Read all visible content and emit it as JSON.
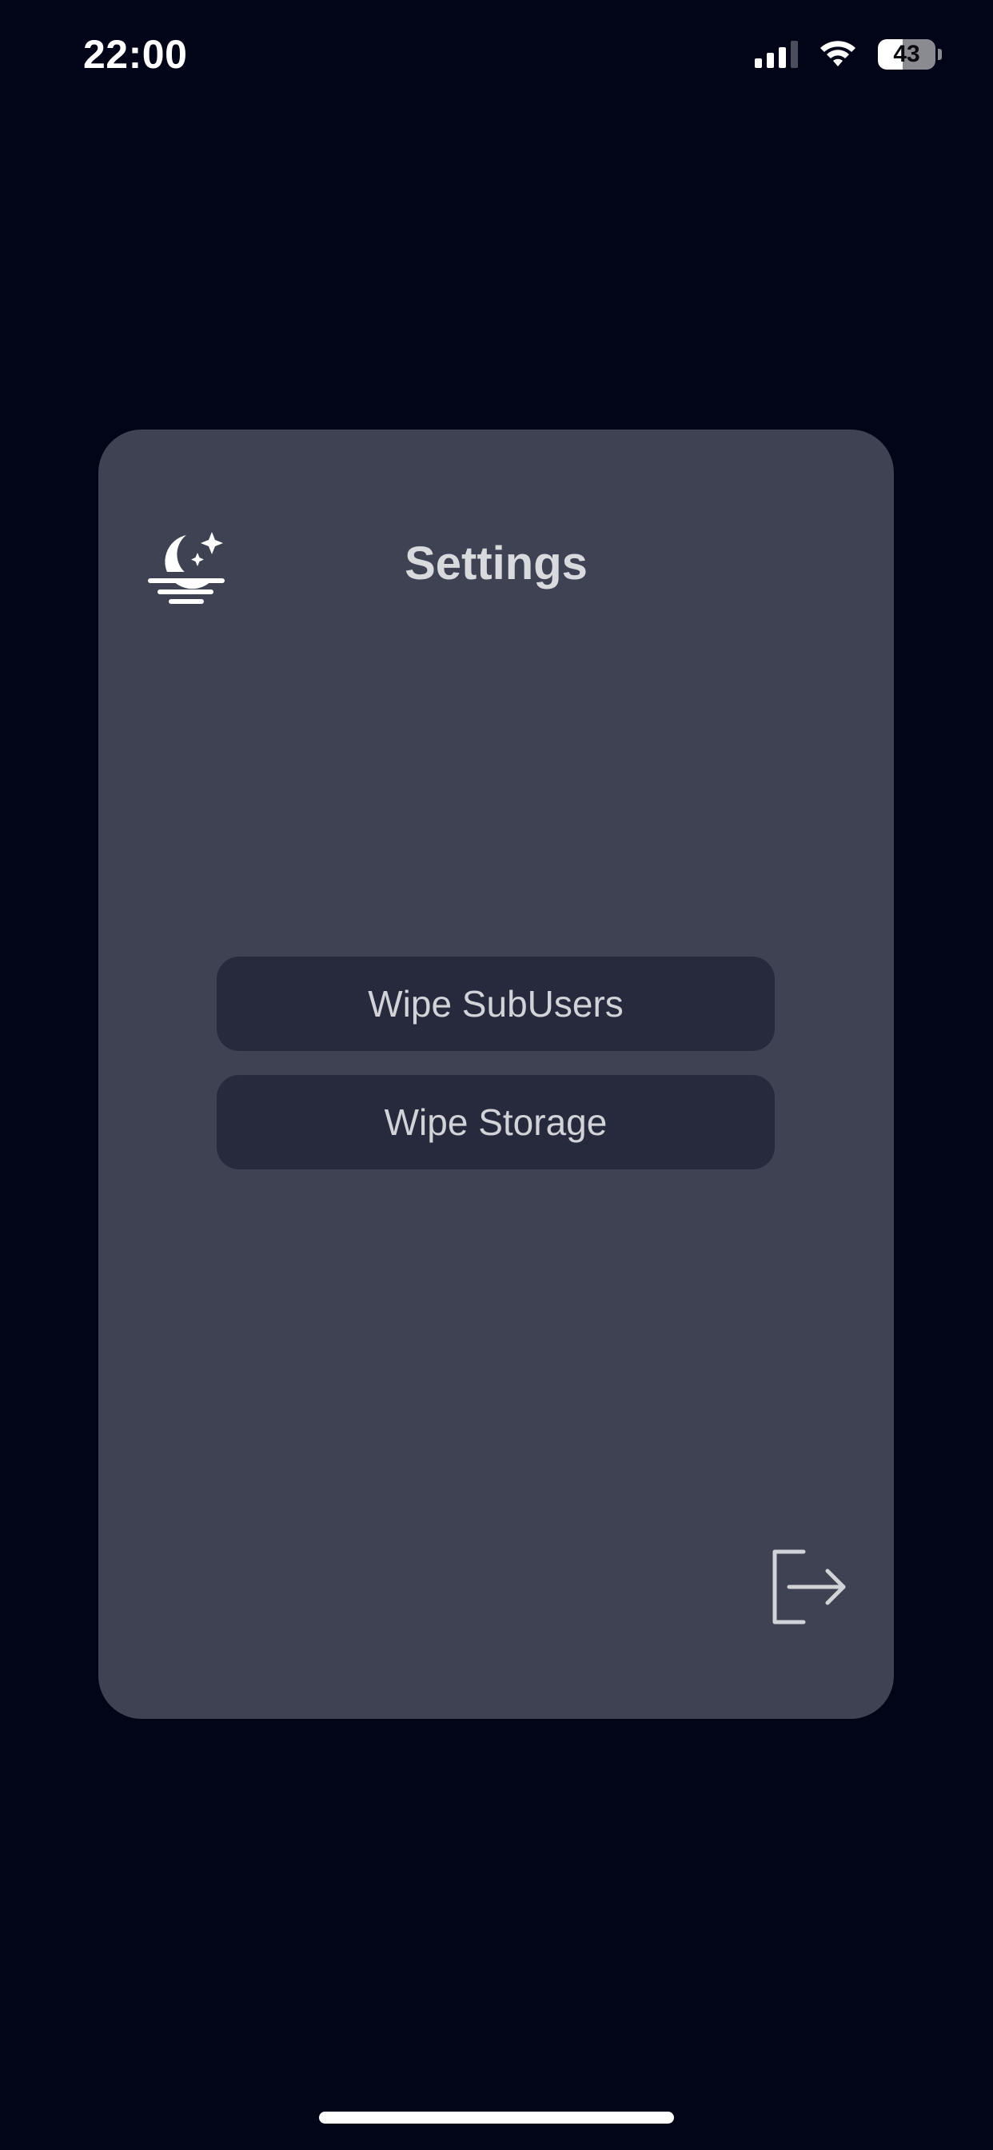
{
  "status_bar": {
    "time": "22:00",
    "battery_text": "43",
    "battery_level": 0.43,
    "signal_bars_active": 3,
    "signal_bars_total": 4,
    "wifi_icon": "wifi-icon"
  },
  "card": {
    "icon": "moon-stars-icon",
    "title": "Settings",
    "buttons": [
      {
        "label": "Wipe SubUsers"
      },
      {
        "label": "Wipe Storage"
      }
    ],
    "logout_icon": "logout-icon"
  },
  "colors": {
    "background": "#020417",
    "card": "#3f4252",
    "button": "#272a3d",
    "text": "#d2d3d8"
  }
}
